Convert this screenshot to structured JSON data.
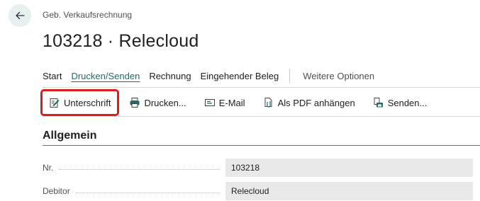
{
  "header": {
    "breadcrumb": "Geb. Verkaufsrechnung",
    "title": "103218 · Relecloud"
  },
  "actionbar": {
    "tabs": [
      {
        "label": "Start"
      },
      {
        "label": "Drucken/Senden"
      },
      {
        "label": "Rechnung"
      },
      {
        "label": "Eingehender Beleg"
      }
    ],
    "more_label": "Weitere Optionen"
  },
  "toolbar": {
    "items": [
      {
        "label": "Unterschrift",
        "icon": "signature-icon"
      },
      {
        "label": "Drucken...",
        "icon": "printer-icon"
      },
      {
        "label": "E-Mail",
        "icon": "email-icon"
      },
      {
        "label": "Als PDF anhängen",
        "icon": "pdf-attach-icon"
      },
      {
        "label": "Senden...",
        "icon": "send-icon"
      }
    ]
  },
  "section": {
    "title": "Allgemein",
    "fields": [
      {
        "label": "Nr.",
        "value": "103218"
      },
      {
        "label": "Debitor",
        "value": "Relecloud"
      }
    ]
  },
  "colors": {
    "accent": "#1b6f6a",
    "highlight_border": "#e01b1b",
    "field_bg": "#e9e9e9"
  }
}
